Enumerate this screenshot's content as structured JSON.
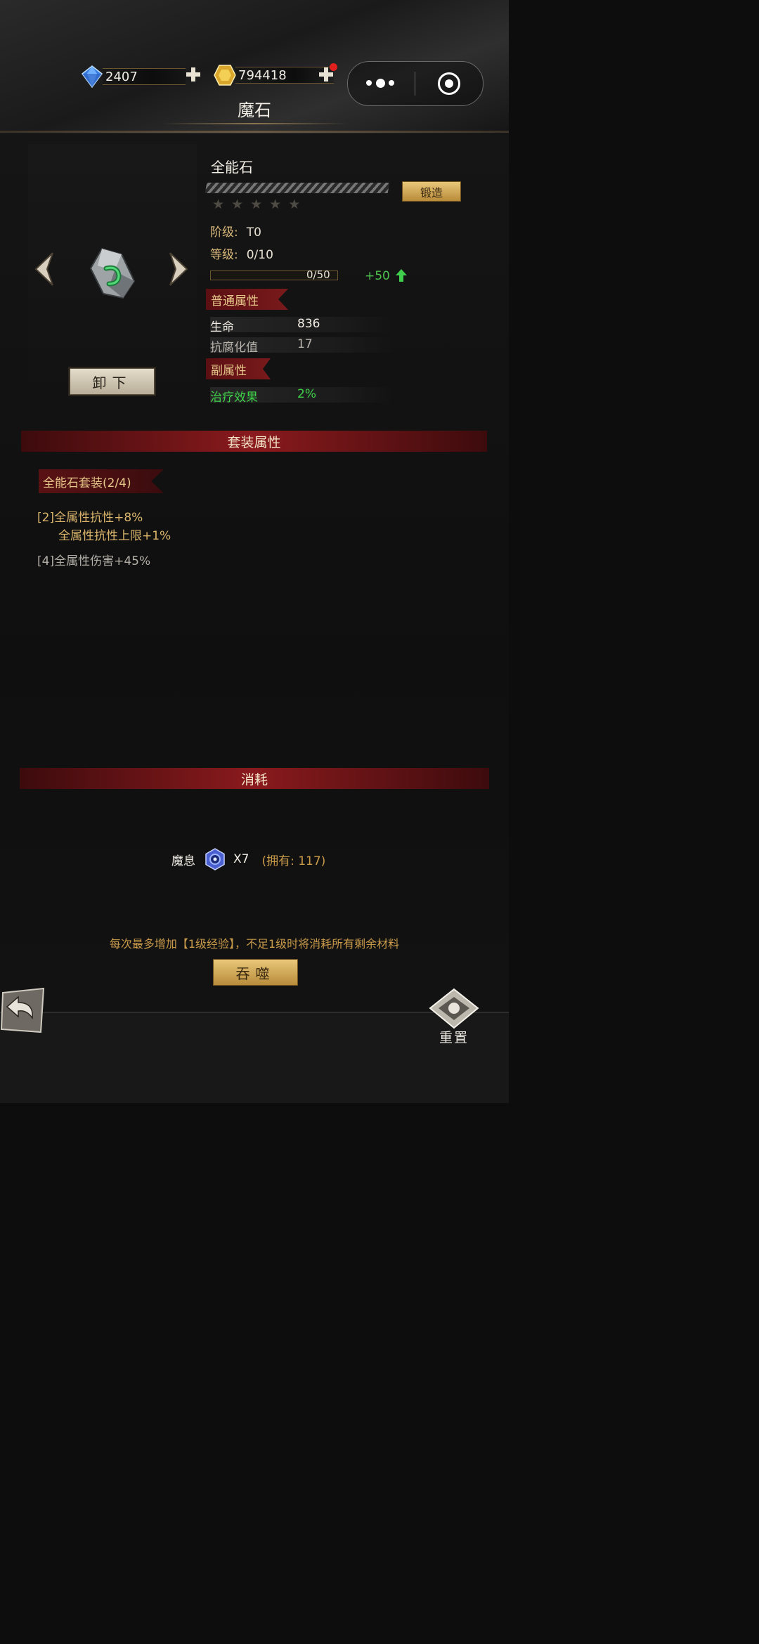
{
  "header": {
    "title": "魔石",
    "diamonds": "2407",
    "gold": "794418"
  },
  "item": {
    "name": "全能石",
    "forge_label": "锻造",
    "stars_total": 5,
    "stars_filled": 0,
    "tier_label": "阶级:",
    "tier_value": "T0",
    "level_label": "等级:",
    "level_value": "0/10",
    "exp_text": "0/50",
    "exp_progress": 0,
    "exp_bonus": "+50",
    "unequip_label": "卸下"
  },
  "basic_attrs": {
    "title": "普通属性",
    "rows": [
      {
        "name": "生命",
        "value": "836"
      },
      {
        "name": "抗腐化值",
        "value": "17"
      }
    ]
  },
  "sub_attrs": {
    "title": "副属性",
    "rows": [
      {
        "name": "治疗效果",
        "value": "2%"
      }
    ]
  },
  "set_bonus": {
    "title": "套装属性",
    "set_name": "全能石套装(2/4)",
    "tier2_tag": "[2]",
    "tier2_line1": "全属性抗性+8%",
    "tier2_line2": "全属性抗性上限+1%",
    "tier4_tag": "[4]",
    "tier4_line1": "全属性伤害+45%"
  },
  "consume": {
    "title": "消耗",
    "material": "魔息",
    "qty": "X7",
    "owned": "(拥有: 117)",
    "notice": "每次最多增加【1级经验】，不足1级时将消耗所有剩余材料",
    "devour_label": "吞噬"
  },
  "footer": {
    "reset_label": "重置"
  },
  "colors": {
    "gold_text": "#dcb66c",
    "green_text": "#4ec24e",
    "ribbon_red": "#7a1a1c",
    "button_gold": "#d9b060"
  }
}
